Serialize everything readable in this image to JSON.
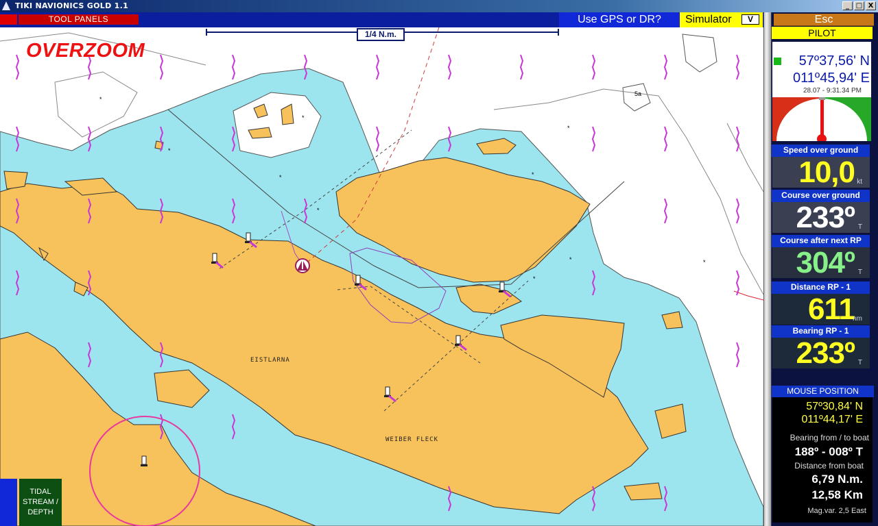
{
  "window": {
    "title": "TIKI NAVIONICS GOLD 1.1",
    "controls": {
      "minimize": "_",
      "maximize": "□",
      "close": "X"
    }
  },
  "toolbar": {
    "tool_panels": "TOOL PANELS",
    "gps_question": "Use GPS or DR?",
    "mode_selected": "Simulator",
    "mode_button": "V"
  },
  "map": {
    "overzoom_label": "OVERZOOM",
    "scale_label": "1/4 N.m.",
    "place_names": [
      "EISTLARNA",
      "WEIBER FLECK"
    ],
    "colors": {
      "land": "#f7c15c",
      "shallow_water": "#9ce5ee",
      "deep_water": "#ffffff",
      "marker": "#c837d6"
    }
  },
  "tidal_button": "TIDAL STREAM / DEPTH",
  "panel": {
    "esc": "Esc",
    "pilot": "PILOT",
    "boat_position": {
      "lat": "57º37,56' N",
      "lon": "011º45,94' E",
      "datetime": "28.07 - 9:31.34 PM"
    },
    "instruments": [
      {
        "label": "Speed over ground",
        "value": "10,0",
        "unit": "kt",
        "color": "#ffff22"
      },
      {
        "label": "Course over ground",
        "value": "233º",
        "unit": "T",
        "color": "#ffffff"
      },
      {
        "label": "Course after next RP",
        "value": "304º",
        "unit": "T",
        "color": "#88f088"
      },
      {
        "label": "Distance RP - 1",
        "value": "611",
        "unit": "nm",
        "color": "#ffff22"
      },
      {
        "label": "Bearing RP - 1",
        "value": "233º",
        "unit": "T",
        "color": "#ffff22"
      }
    ],
    "mouse": {
      "header": "MOUSE POSITION",
      "lat": "57º30,84' N",
      "lon": "011º44,17' E",
      "bearing_label": "Bearing from / to boat",
      "bearing_value": "188º - 008º T",
      "distance_label": "Distance from boat",
      "distance_nm": "6,79 N.m.",
      "distance_km": "12,58 Km",
      "magvar": "Mag.var.  2,5  East"
    }
  }
}
